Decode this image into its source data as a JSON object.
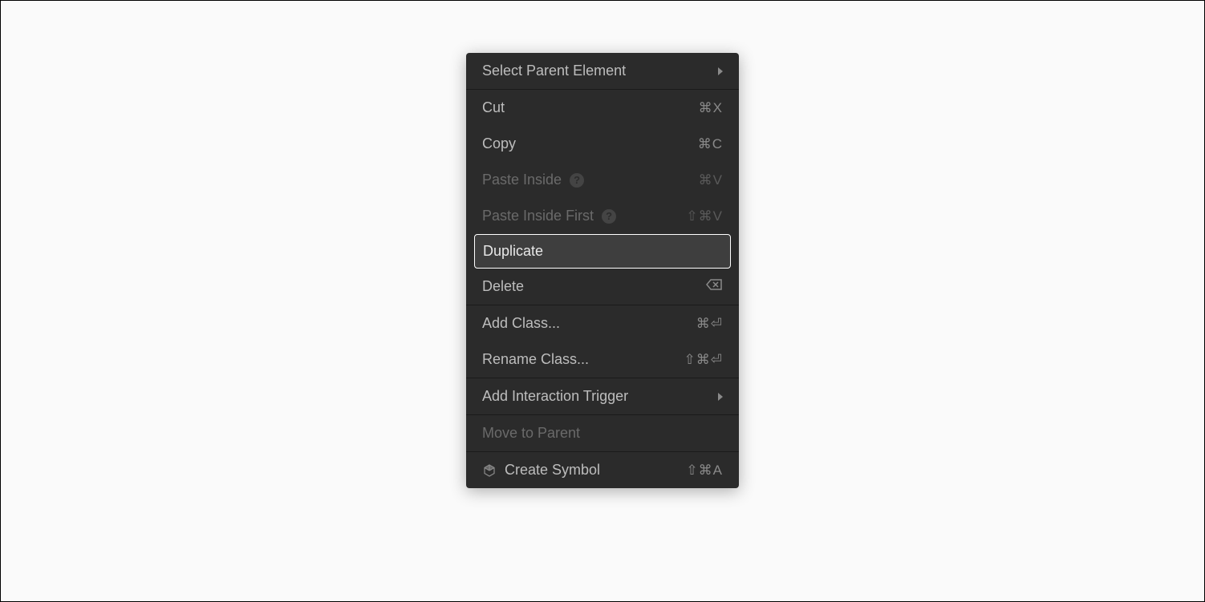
{
  "menu": {
    "selectParent": {
      "label": "Select Parent Element"
    },
    "cut": {
      "label": "Cut",
      "shortcut": "⌘X"
    },
    "copy": {
      "label": "Copy",
      "shortcut": "⌘C"
    },
    "pasteInside": {
      "label": "Paste Inside",
      "shortcut": "⌘V"
    },
    "pasteInsideFirst": {
      "label": "Paste Inside First",
      "shortcut": "⇧⌘V"
    },
    "duplicate": {
      "label": "Duplicate"
    },
    "delete": {
      "label": "Delete"
    },
    "addClass": {
      "label": "Add Class...",
      "shortcut": "⌘⏎"
    },
    "renameClass": {
      "label": "Rename Class...",
      "shortcut": "⇧⌘⏎"
    },
    "addInteractionTrigger": {
      "label": "Add Interaction Trigger"
    },
    "moveToParent": {
      "label": "Move to Parent"
    },
    "createSymbol": {
      "label": "Create Symbol",
      "shortcut": "⇧⌘A"
    }
  }
}
